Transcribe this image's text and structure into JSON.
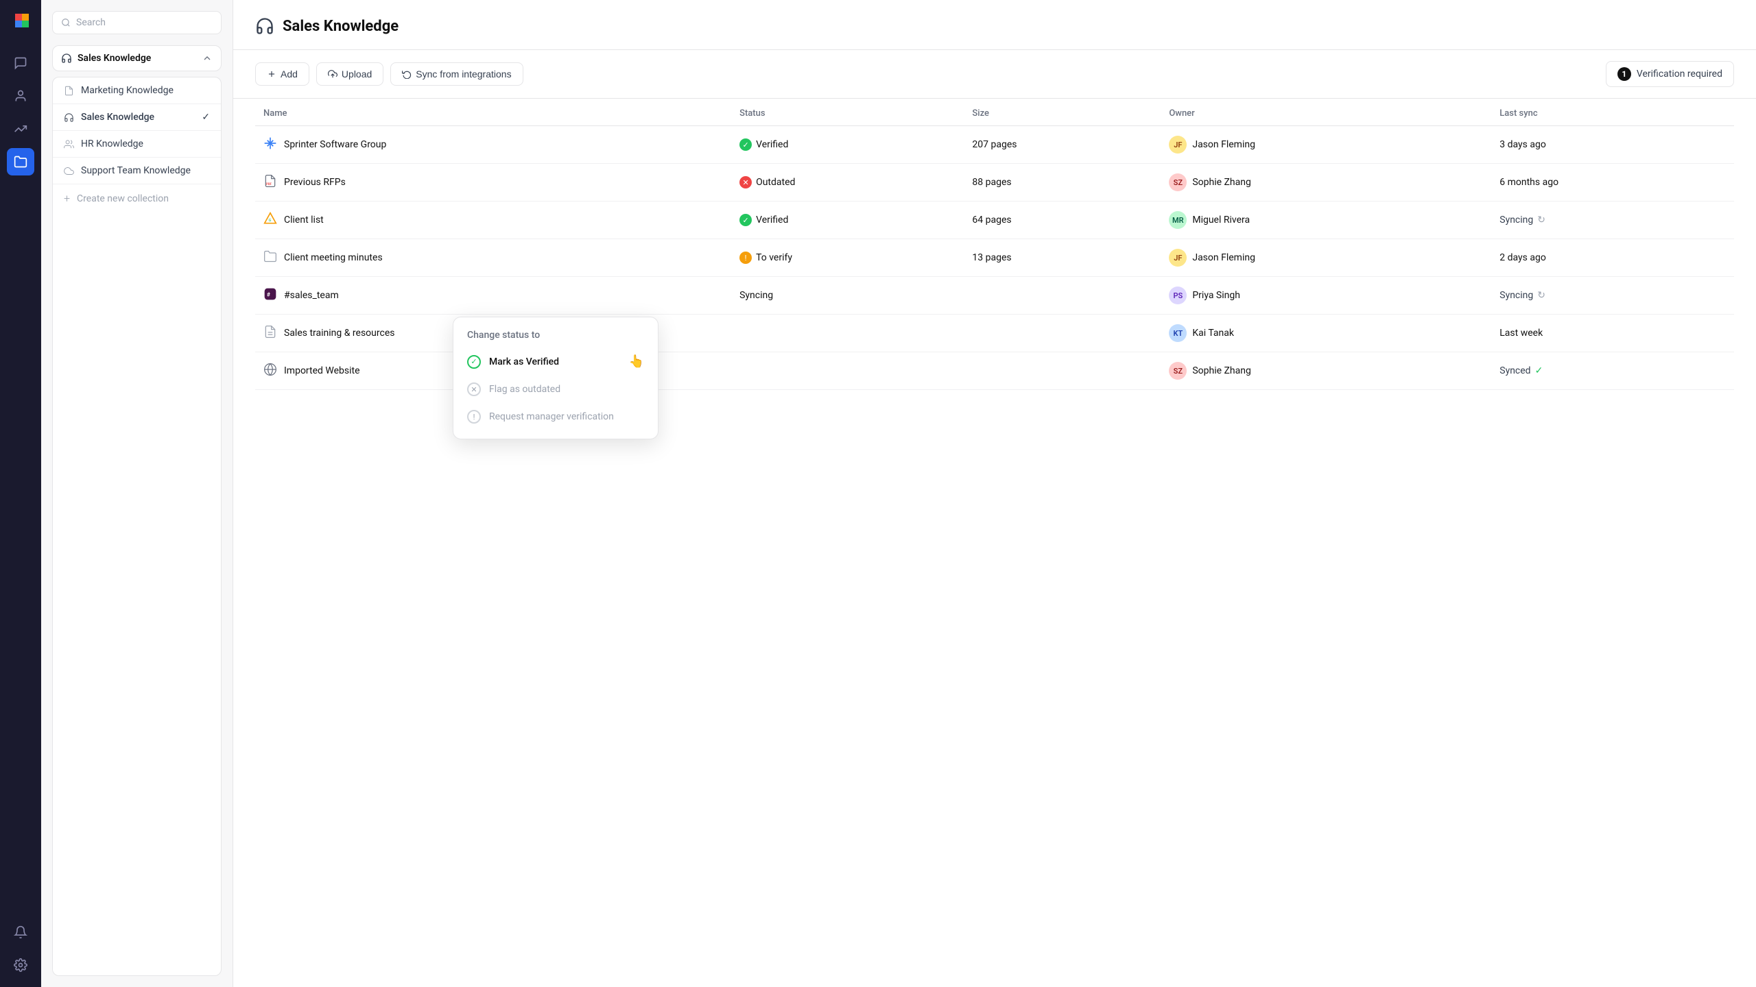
{
  "app": {
    "title": "Sales Knowledge"
  },
  "iconBar": {
    "items": [
      {
        "name": "chat-icon",
        "symbol": "💬",
        "active": false
      },
      {
        "name": "users-icon",
        "symbol": "👤",
        "active": false
      },
      {
        "name": "analytics-icon",
        "symbol": "↗",
        "active": false
      },
      {
        "name": "folder-icon",
        "symbol": "🗂",
        "active": true
      }
    ],
    "bottomItems": [
      {
        "name": "bell-icon",
        "symbol": "🔔"
      },
      {
        "name": "settings-icon",
        "symbol": "⚙"
      }
    ]
  },
  "sidebar": {
    "search_placeholder": "Search",
    "collection_label": "Sales Knowledge",
    "items": [
      {
        "label": "Marketing Knowledge",
        "icon": "📄",
        "active": false,
        "check": false
      },
      {
        "label": "Sales Knowledge",
        "icon": "🎧",
        "active": true,
        "check": true
      },
      {
        "label": "HR Knowledge",
        "icon": "👥",
        "active": false,
        "check": false
      },
      {
        "label": "Support Team Knowledge",
        "icon": "☁",
        "active": false,
        "check": false
      },
      {
        "label": "Create new collection",
        "icon": "+",
        "active": false,
        "check": false,
        "create": true
      }
    ]
  },
  "toolbar": {
    "add_label": "Add",
    "upload_label": "Upload",
    "sync_label": "Sync from integrations",
    "verification_count": "1",
    "verification_label": "Verification required"
  },
  "table": {
    "columns": [
      "Name",
      "Status",
      "Size",
      "Owner",
      "Last sync"
    ],
    "rows": [
      {
        "name": "Sprinter Software Group",
        "icon": "❄",
        "icon_type": "snowflake",
        "status": "Verified",
        "status_type": "verified",
        "size": "207 pages",
        "owner": "Jason Fleming",
        "owner_initials": "JF",
        "owner_class": "jf",
        "last_sync": "3 days ago",
        "sync_type": "text"
      },
      {
        "name": "Previous RFPs",
        "icon": "📄",
        "icon_type": "pdf",
        "status": "Outdated",
        "status_type": "outdated",
        "size": "88 pages",
        "owner": "Sophie Zhang",
        "owner_initials": "SZ",
        "owner_class": "sz",
        "last_sync": "6 months ago",
        "sync_type": "text"
      },
      {
        "name": "Client list",
        "icon": "🔺",
        "icon_type": "gdrive",
        "status": "Verified",
        "status_type": "verified",
        "size": "64 pages",
        "owner": "Miguel Rivera",
        "owner_initials": "MR",
        "owner_class": "mr",
        "last_sync": "Syncing",
        "sync_type": "syncing"
      },
      {
        "name": "Client meeting minutes",
        "icon": "📁",
        "icon_type": "folder",
        "status": "To verify",
        "status_type": "to-verify",
        "size": "13 pages",
        "owner": "Jason Fleming",
        "owner_initials": "JF",
        "owner_class": "jf",
        "last_sync": "2 days ago",
        "sync_type": "text"
      },
      {
        "name": "#sales_team",
        "icon": "💬",
        "icon_type": "slack",
        "status": "Syncing",
        "status_type": "syncing",
        "size": "",
        "owner": "Priya Singh",
        "owner_initials": "PS",
        "owner_class": "ps",
        "last_sync": "Syncing",
        "sync_type": "syncing"
      },
      {
        "name": "Sales training & resources",
        "icon": "📋",
        "icon_type": "doc",
        "status": "",
        "status_type": "",
        "size": "",
        "owner": "Kai Tanak",
        "owner_initials": "KT",
        "owner_class": "kt",
        "last_sync": "Last week",
        "sync_type": "text"
      },
      {
        "name": "Imported Website",
        "icon": "🌐",
        "icon_type": "web",
        "status": "",
        "status_type": "",
        "size": "",
        "owner": "Sophie Zhang",
        "owner_initials": "SZ",
        "owner_class": "sz",
        "last_sync": "Synced",
        "sync_type": "synced"
      }
    ]
  },
  "contextMenu": {
    "header": "Change status to",
    "items": [
      {
        "label": "Mark as Verified",
        "icon": "✓",
        "icon_class": "green",
        "active": true,
        "disabled": false
      },
      {
        "label": "Flag as outdated",
        "icon": "✕",
        "icon_class": "gray",
        "active": false,
        "disabled": true
      },
      {
        "label": "Request manager verification",
        "icon": "!",
        "icon_class": "gray",
        "active": false,
        "disabled": true
      }
    ]
  }
}
